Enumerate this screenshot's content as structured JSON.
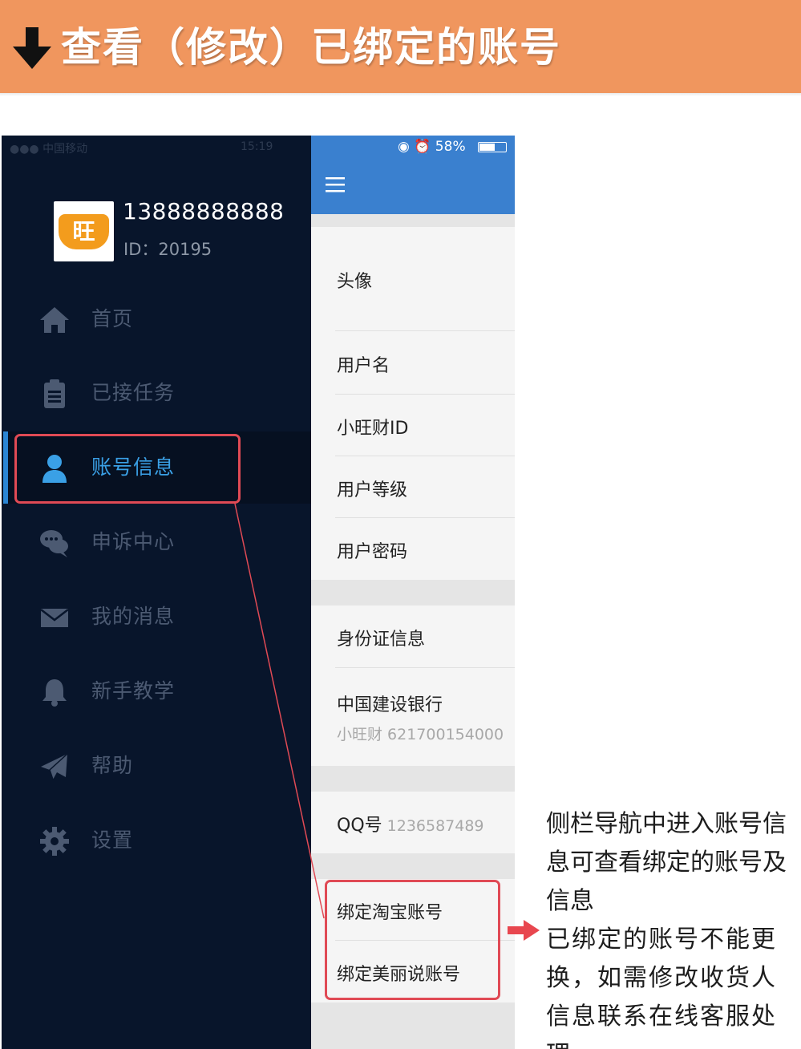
{
  "header": {
    "title": "查看（修改）已绑定的账号",
    "arrow_icon": "down-arrow-icon",
    "background_color": "#f0965e"
  },
  "sidebar": {
    "status_left": "●●●  中国移动  ",
    "status_time": "15:19",
    "avatar_text": "旺",
    "phone": "13888888888",
    "user_id": "ID：20195",
    "items": [
      {
        "label": "首页",
        "icon": "home-icon",
        "active": false
      },
      {
        "label": "已接任务",
        "icon": "clipboard-icon",
        "active": false
      },
      {
        "label": "账号信息",
        "icon": "user-icon",
        "active": true
      },
      {
        "label": "申诉中心",
        "icon": "chat-bubbles-icon",
        "active": false
      },
      {
        "label": "我的消息",
        "icon": "envelope-icon",
        "active": false
      },
      {
        "label": "新手教学",
        "icon": "bell-icon",
        "active": false
      },
      {
        "label": "帮助",
        "icon": "paper-plane-icon",
        "active": false
      },
      {
        "label": "设置",
        "icon": "gear-icon",
        "active": false
      }
    ],
    "active_color": "#3aa0e6"
  },
  "panel": {
    "status_text": "◉  ⏰ 58%",
    "battery_level": 0.58,
    "accent_color": "#3a80cf",
    "rows": {
      "avatar": "头像",
      "username": "用户名",
      "xwc_id": "小旺财ID",
      "level": "用户等级",
      "password": "用户密码",
      "id_card": "身份证信息",
      "bank": "中国建设银行",
      "bank_sub": "小旺财 621700154000",
      "qq_label": "QQ号",
      "qq_value": "1236587489",
      "taobao": "绑定淘宝账号",
      "meilishuo": "绑定美丽说账号"
    }
  },
  "note": {
    "line1": "侧栏导航中进入账号信息可查看绑定的账号及信息",
    "line2": "已绑定的账号不能更换，如需修改收货人信息联系在线客服处理。",
    "highlight_color": "#e04a55"
  }
}
